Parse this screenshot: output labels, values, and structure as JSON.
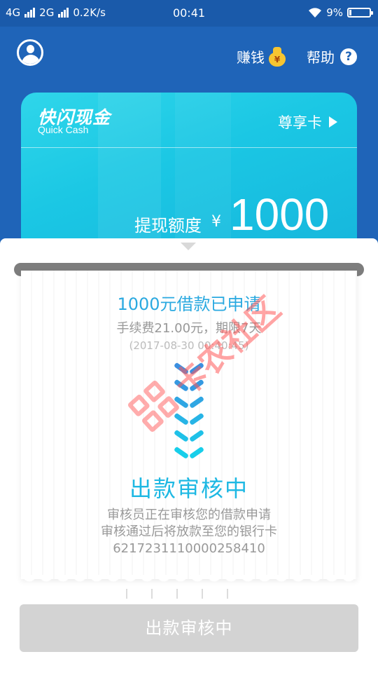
{
  "status_bar": {
    "net1": "4G",
    "net2": "2G",
    "speed": "0.2K/s",
    "time": "00:41",
    "battery": "9%",
    "battery_level": 0.09
  },
  "header": {
    "earn_label": "赚钱",
    "moneybag_glyph": "¥",
    "help_label": "帮助",
    "help_glyph": "?"
  },
  "card": {
    "logo_cn": "快闪现金",
    "logo_en": "Quick Cash",
    "vip_label": "尊享卡",
    "quota_label": "提现额度",
    "currency": "¥",
    "quota_value": "1000"
  },
  "receipt": {
    "loan_title": "1000元借款已申请",
    "fee_line": "手续费21.00元，期限7天",
    "time_line": "(2017-08-30 00:40:45)",
    "review_title": "出款审核中",
    "desc_line1": "审核员正在审核您的借款申请",
    "desc_line2": "审核通过后将放款至您的银行卡",
    "card_number": "6217231110000258410"
  },
  "action_button": {
    "label": "出款审核中"
  },
  "watermark": {
    "text": "卡农社区"
  },
  "colors": {
    "header_blue": "#1f64b8",
    "card_cyan": "#1bc7e4",
    "title_blue": "#2aa9e0",
    "disabled_gray": "#d3d3d3"
  }
}
